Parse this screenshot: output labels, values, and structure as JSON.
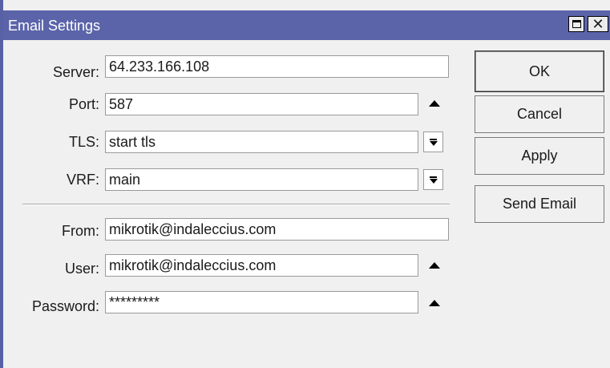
{
  "window": {
    "title": "Email Settings",
    "maximize_icon": "maximize-icon",
    "close_icon": "close-icon",
    "close_glyph": "✕"
  },
  "form": {
    "server": {
      "label": "Server:",
      "value": "64.233.166.108"
    },
    "port": {
      "label": "Port:",
      "value": "587"
    },
    "tls": {
      "label": "TLS:",
      "value": "start tls"
    },
    "vrf": {
      "label": "VRF:",
      "value": "main"
    },
    "from": {
      "label": "From:",
      "value": "mikrotik@indaleccius.com"
    },
    "user": {
      "label": "User:",
      "value": "mikrotik@indaleccius.com"
    },
    "password": {
      "label": "Password:",
      "value": "*********"
    }
  },
  "buttons": {
    "ok": "OK",
    "cancel": "Cancel",
    "apply": "Apply",
    "send_email": "Send Email"
  },
  "colors": {
    "titlebar": "#5b64a9",
    "window_bg": "#f0f0f0"
  }
}
